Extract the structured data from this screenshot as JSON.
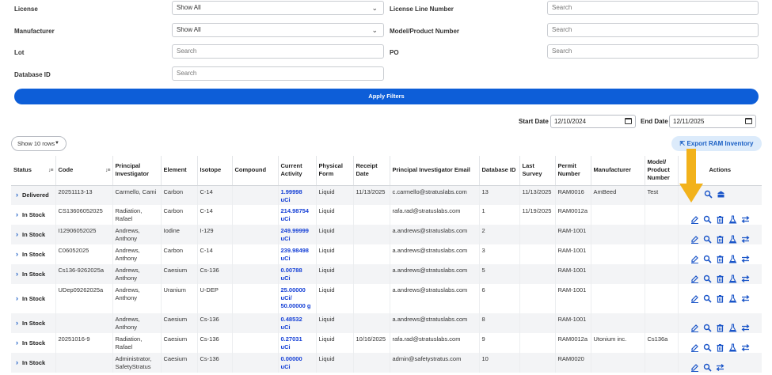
{
  "filters": {
    "rows": [
      {
        "left_label": "License",
        "left_value": "Show All",
        "left_type": "select",
        "right_label": "License Line Number",
        "right_placeholder": "Search"
      },
      {
        "left_label": "Manufacturer",
        "left_value": "Show All",
        "left_type": "select",
        "right_label": "Model/Product Number",
        "right_placeholder": "Search"
      },
      {
        "left_label": "Lot",
        "left_placeholder": "Search",
        "left_type": "input",
        "right_label": "PO",
        "right_placeholder": "Search"
      },
      {
        "left_label": "Database ID",
        "left_placeholder": "Search",
        "left_type": "input"
      }
    ],
    "apply_label": "Apply Filters"
  },
  "dates": {
    "start_label": "Start Date",
    "start_value": "12/10/2024",
    "end_label": "End Date",
    "end_value": "12/11/2025"
  },
  "show_rows": "Show 10 rows",
  "export_label": "Export RAM Inventory",
  "columns": [
    "Status",
    "Code",
    "Principal Investigator",
    "Element",
    "Isotope",
    "Compound",
    "Current Activity",
    "Physical Form",
    "Receipt Date",
    "Principal Investigator Email",
    "Database ID",
    "Last Survey",
    "Permit Number",
    "Manufacturer",
    "Model/ Product Number",
    "Actions"
  ],
  "rows": [
    {
      "status": "Delivered",
      "code": "20251113-13",
      "pi": "Carmello, Cami",
      "element": "Carbon",
      "isotope": "C-14",
      "compound": "",
      "activity": "1.99998 uCi",
      "form": "Liquid",
      "receipt": "11/13/2025",
      "email": "c.carmello@stratuslabs.com",
      "dbid": "13",
      "survey": "11/13/2025",
      "permit": "RAM0016",
      "mfr": "AmBeed",
      "model": "Test",
      "actions": "delivered"
    },
    {
      "status": "In Stock",
      "code": "CS13606052025",
      "pi": "Radiation, Rafael",
      "element": "Carbon",
      "isotope": "C-14",
      "compound": "",
      "activity": "214.98754 uCi",
      "form": "Liquid",
      "receipt": "",
      "email": "rafa.rad@stratuslabs.com",
      "dbid": "1",
      "survey": "11/19/2025",
      "permit": "RAM0012a",
      "mfr": "",
      "model": "",
      "actions": "full"
    },
    {
      "status": "In Stock",
      "code": "I12906052025",
      "pi": "Andrews, Anthony",
      "element": "Iodine",
      "isotope": "I-129",
      "compound": "",
      "activity": "249.99999 uCi",
      "form": "Liquid",
      "receipt": "",
      "email": "a.andrews@stratuslabs.com",
      "dbid": "2",
      "survey": "",
      "permit": "RAM-1001",
      "mfr": "",
      "model": "",
      "actions": "full"
    },
    {
      "status": "In Stock",
      "code": "C06052025",
      "pi": "Andrews, Anthony",
      "element": "Carbon",
      "isotope": "C-14",
      "compound": "",
      "activity": "239.98498 uCi",
      "form": "Liquid",
      "receipt": "",
      "email": "a.andrews@stratuslabs.com",
      "dbid": "3",
      "survey": "",
      "permit": "RAM-1001",
      "mfr": "",
      "model": "",
      "actions": "full"
    },
    {
      "status": "In Stock",
      "code": "Cs136-9262025a",
      "pi": "Andrews, Anthony",
      "element": "Caesium",
      "isotope": "Cs-136",
      "compound": "",
      "activity": "0.00788 uCi",
      "form": "Liquid",
      "receipt": "",
      "email": "a.andrews@stratuslabs.com",
      "dbid": "5",
      "survey": "",
      "permit": "RAM-1001",
      "mfr": "",
      "model": "",
      "actions": "full"
    },
    {
      "status": "In Stock",
      "code": "UDep09262025a",
      "pi": "Andrews, Anthony",
      "element": "Uranium",
      "isotope": "U-DEP",
      "compound": "",
      "activity": "25.00000 uCi/ 50.00000 g",
      "form": "Liquid",
      "receipt": "",
      "email": "a.andrews@stratuslabs.com",
      "dbid": "6",
      "survey": "",
      "permit": "RAM-1001",
      "mfr": "",
      "model": "",
      "actions": "full"
    },
    {
      "status": "In Stock",
      "code": "",
      "pi": "Andrews, Anthony",
      "element": "Caesium",
      "isotope": "Cs-136",
      "compound": "",
      "activity": "0.48532 uCi",
      "form": "Liquid",
      "receipt": "",
      "email": "a.andrews@stratuslabs.com",
      "dbid": "8",
      "survey": "",
      "permit": "RAM-1001",
      "mfr": "",
      "model": "",
      "actions": "full"
    },
    {
      "status": "In Stock",
      "code": "20251016-9",
      "pi": "Radiation, Rafael",
      "element": "Caesium",
      "isotope": "Cs-136",
      "compound": "",
      "activity": "0.27031 uCi",
      "form": "Liquid",
      "receipt": "10/16/2025",
      "email": "rafa.rad@stratuslabs.com",
      "dbid": "9",
      "survey": "",
      "permit": "RAM0012a",
      "mfr": "Utonium inc.",
      "model": "Cs136a",
      "actions": "full"
    },
    {
      "status": "In Stock",
      "code": "",
      "pi": "Administrator, SafetyStratus",
      "element": "Caesium",
      "isotope": "Cs-136",
      "compound": "",
      "activity": "0.00000 uCi",
      "form": "Liquid",
      "receipt": "",
      "email": "admin@safetystratus.com",
      "dbid": "10",
      "survey": "",
      "permit": "RAM0020",
      "mfr": "",
      "model": "",
      "actions": "short"
    }
  ]
}
